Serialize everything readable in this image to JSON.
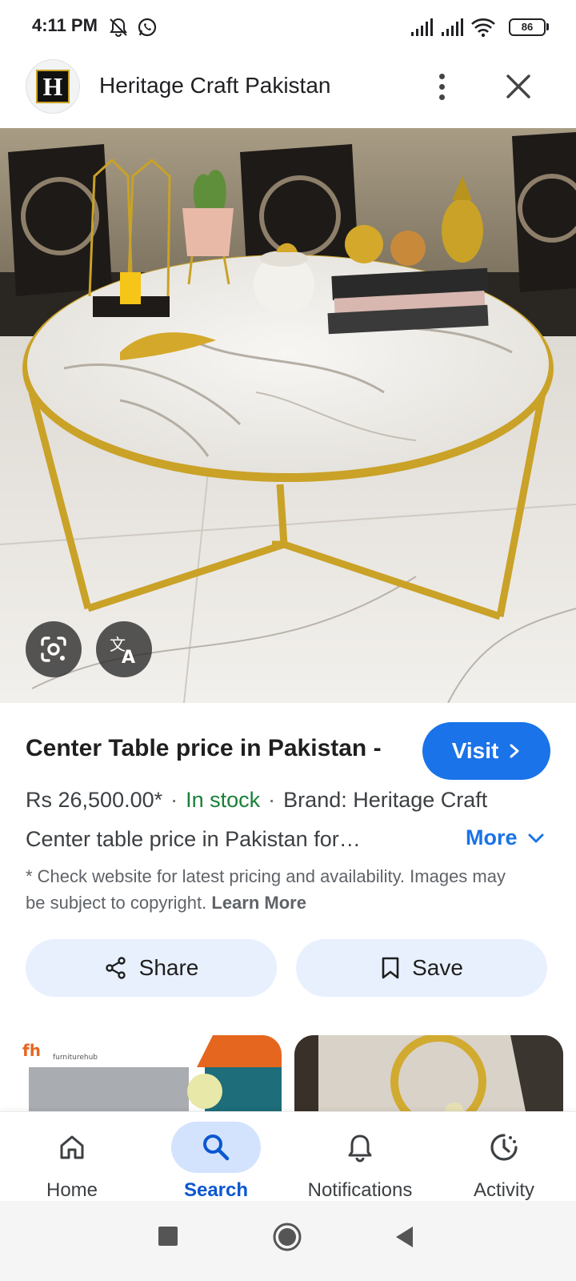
{
  "status_bar": {
    "time": "4:11 PM",
    "battery": "86",
    "icons": [
      "mute-notification-icon",
      "whatsapp-icon",
      "signal-icon",
      "signal-icon",
      "wifi-icon",
      "battery-icon"
    ]
  },
  "header": {
    "site_name": "Heritage Craft Pakistan",
    "logo_letter": "H",
    "menu_icon": "more-vert-icon",
    "close_icon": "close-icon"
  },
  "image": {
    "lens_icon": "google-lens-icon",
    "translate_icon": "translate-icon"
  },
  "product": {
    "title": "Center Table price in Pakistan -",
    "visit_label": "Visit",
    "price": "Rs 26,500.00*",
    "stock": "In stock",
    "brand": "Brand: Heritage Craft",
    "description": "Center table price in Pakistan for…",
    "more_label": "More",
    "disclaimer": "* Check website for latest pricing and availability. Images may be subject to copyright.",
    "learn_more": "Learn More"
  },
  "actions": {
    "share_label": "Share",
    "save_label": "Save"
  },
  "related": {
    "thumb1_brand": "furniturehub"
  },
  "bottom_nav": {
    "items": [
      {
        "label": "Home",
        "icon": "home-icon"
      },
      {
        "label": "Search",
        "icon": "search-icon",
        "active": true
      },
      {
        "label": "Notifications",
        "icon": "bell-icon"
      },
      {
        "label": "Activity",
        "icon": "activity-icon"
      }
    ]
  },
  "colors": {
    "accent": "#1a73e8",
    "stock_green": "#188038",
    "button_bg": "#e8f0fe",
    "nav_active_bg": "#d3e3fd",
    "nav_active_text": "#0b57d0"
  }
}
